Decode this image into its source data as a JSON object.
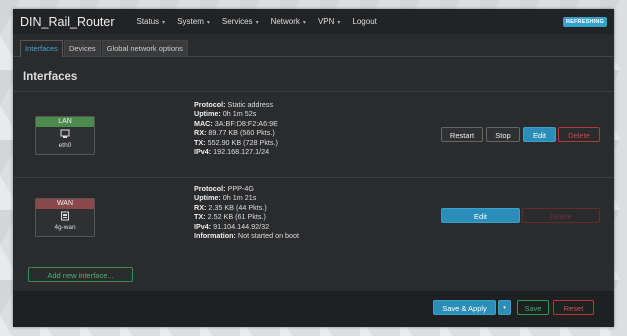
{
  "header": {
    "brand": "DIN_Rail_Router",
    "menu": [
      {
        "label": "Status",
        "dropdown": true
      },
      {
        "label": "System",
        "dropdown": true
      },
      {
        "label": "Services",
        "dropdown": true
      },
      {
        "label": "Network",
        "dropdown": true
      },
      {
        "label": "VPN",
        "dropdown": true
      },
      {
        "label": "Logout",
        "dropdown": false
      }
    ],
    "status_badge": "REFRESHING",
    "caret_glyph": "▾"
  },
  "tabs": [
    {
      "label": "Interfaces",
      "active": true
    },
    {
      "label": "Devices",
      "active": false
    },
    {
      "label": "Global network options",
      "active": false
    }
  ],
  "section_title": "Interfaces",
  "interfaces": [
    {
      "name": "LAN",
      "device": "eth0",
      "icon": "ethernet-port-icon",
      "color": "#4d8a4e",
      "info": [
        {
          "key": "Protocol:",
          "value": " Static address"
        },
        {
          "key": "Uptime:",
          "value": " 0h 1m 52s"
        },
        {
          "key": "MAC:",
          "value": " 3A:BF:D8:F2:A6:9E"
        },
        {
          "key": "RX:",
          "value": " 89.77 KB (560 Pkts.)"
        },
        {
          "key": "TX:",
          "value": " 552.90 KB (728 Pkts.)"
        },
        {
          "key": "IPv4:",
          "value": " 192.168.127.1/24"
        }
      ],
      "buttons": {
        "restart": "Restart",
        "stop": "Stop",
        "edit": "Edit",
        "delete": "Delete"
      }
    },
    {
      "name": "WAN",
      "device": "4g-wan",
      "icon": "cellular-modem-icon",
      "color": "#8a4a4c",
      "info": [
        {
          "key": "Protocol:",
          "value": " PPP-4G"
        },
        {
          "key": "Uptime:",
          "value": " 0h 1m 21s"
        },
        {
          "key": "RX:",
          "value": " 2.35 KB (44 Pkts.)"
        },
        {
          "key": "TX:",
          "value": " 2.52 KB (61 Pkts.)"
        },
        {
          "key": "IPv4:",
          "value": " 91.104.144.92/32"
        },
        {
          "key": "Information:",
          "value": " Not started on boot"
        }
      ],
      "buttons": {
        "edit": "Edit",
        "delete": "Delete"
      }
    }
  ],
  "add_interface_label": "Add new interface...",
  "footer": {
    "save_apply": "Save & Apply",
    "save_apply_caret": "▾",
    "save": "Save",
    "reset": "Reset"
  }
}
